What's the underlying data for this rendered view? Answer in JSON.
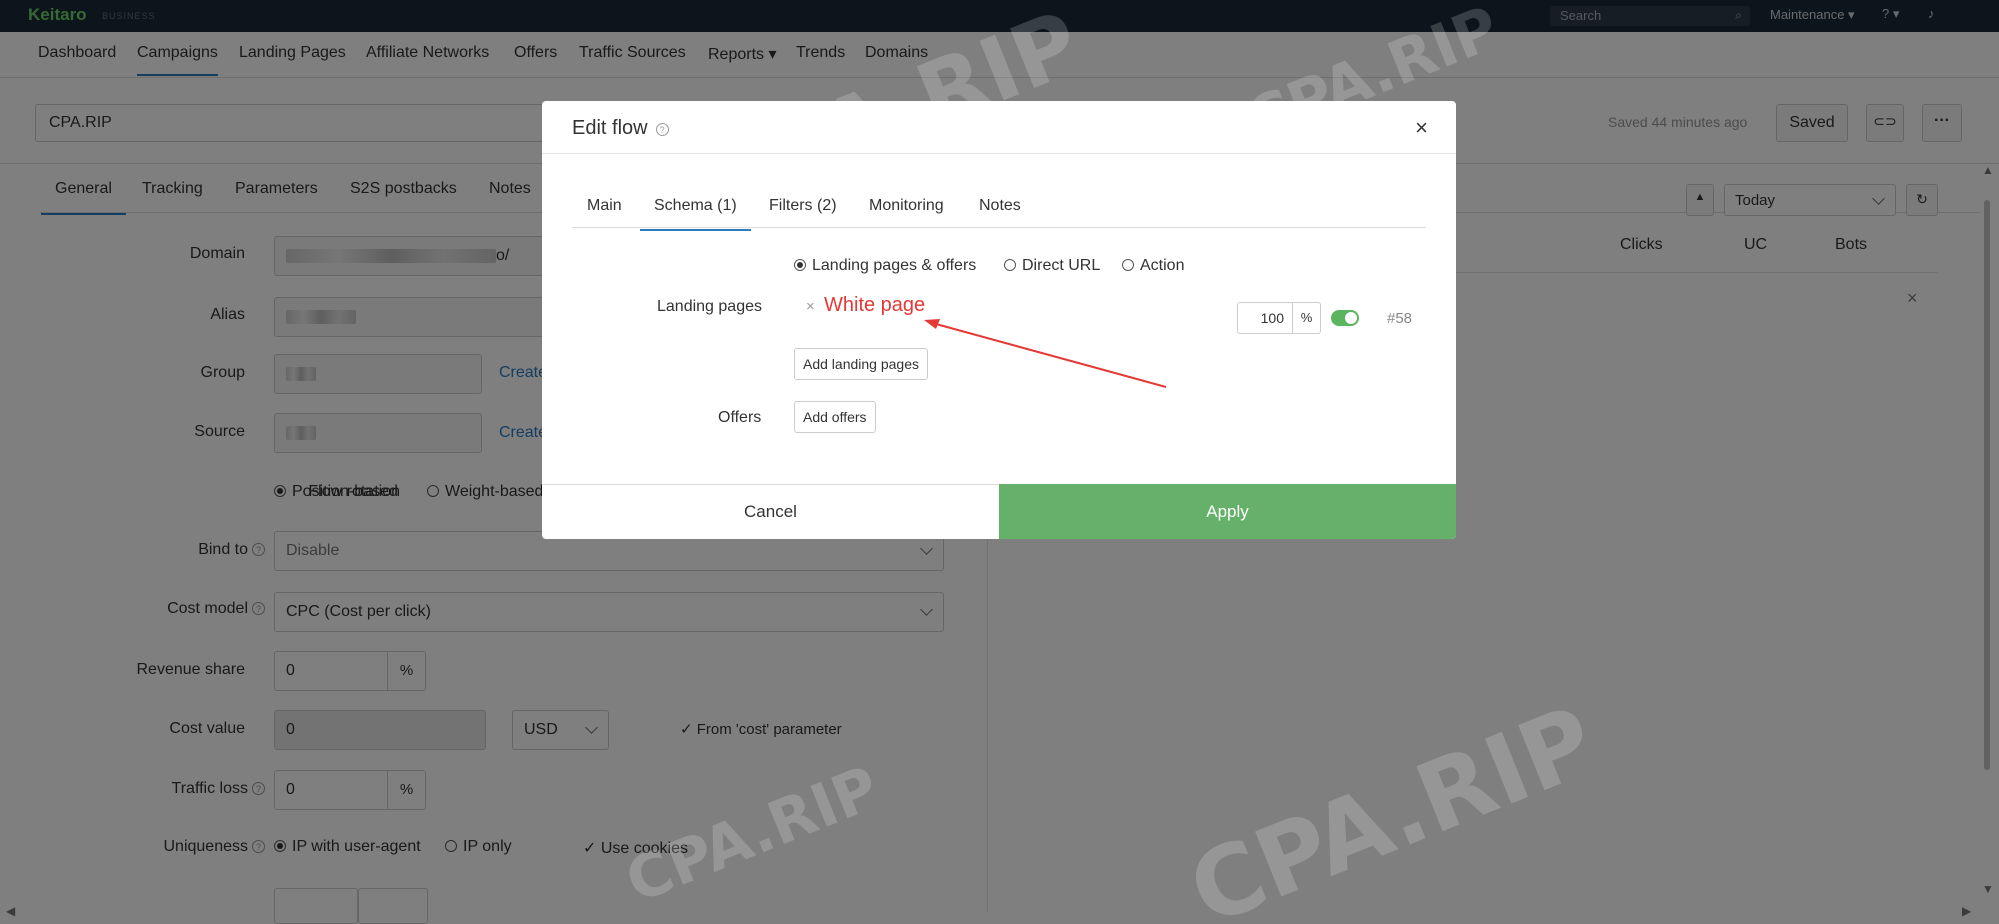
{
  "topbar": {
    "logo": "Keitaro",
    "logo_sub": "BUSINESS",
    "search_placeholder": "Search",
    "maintenance": "Maintenance ▾",
    "help": "? ▾"
  },
  "nav": [
    "Dashboard",
    "Campaigns",
    "Landing Pages",
    "Affiliate Networks",
    "Offers",
    "Traffic Sources",
    "Reports ▾",
    "Trends",
    "Domains"
  ],
  "campaign": {
    "name": "CPA.RIP",
    "saved_time": "Saved 44 minutes ago",
    "saved_button": "Saved"
  },
  "subtabs": [
    "General",
    "Tracking",
    "Parameters",
    "S2S postbacks",
    "Notes"
  ],
  "form": {
    "domain_label": "Domain",
    "domain_suffix": "o/",
    "alias_label": "Alias",
    "group_label": "Group",
    "source_label": "Source",
    "create_link": "Create",
    "flow_rotation_label": "Flow rotation",
    "flow_rotation_opt1": "Position-based",
    "flow_rotation_opt2": "Weight-based",
    "bind_label": "Bind to",
    "bind_value": "Disable",
    "cost_model_label": "Cost model",
    "cost_model_value": "CPC (Cost per click)",
    "revenue_share_label": "Revenue share",
    "revenue_share_value": "0",
    "percent": "%",
    "cost_value_label": "Cost value",
    "cost_value": "0",
    "currency": "USD",
    "from_cost": "From 'cost' parameter",
    "traffic_loss_label": "Traffic loss",
    "traffic_loss_value": "0",
    "uniqueness_label": "Uniqueness",
    "uniq_opt1": "IP with user-agent",
    "uniq_opt2": "IP only",
    "uniq_opt3": "Use cookies"
  },
  "right_panel": {
    "period": "Today",
    "columns": [
      "Clicks",
      "UC",
      "Bots"
    ]
  },
  "modal": {
    "title": "Edit flow",
    "tabs": [
      "Main",
      "Schema (1)",
      "Filters (2)",
      "Monitoring",
      "Notes"
    ],
    "schema_opts": [
      "Landing pages & offers",
      "Direct URL",
      "Action"
    ],
    "landing_pages_label": "Landing pages",
    "landing_page_name": "White page",
    "landing_weight": "100",
    "percent": "%",
    "landing_id": "#58",
    "add_landing": "Add landing pages",
    "offers_label": "Offers",
    "add_offers": "Add offers",
    "cancel": "Cancel",
    "apply": "Apply"
  },
  "watermark": "CPA.RIP",
  "colors": {
    "topbar": "#1b2a38",
    "apply": "#65b16a",
    "accent": "#2a7bbf",
    "highlight": "#e53935"
  }
}
